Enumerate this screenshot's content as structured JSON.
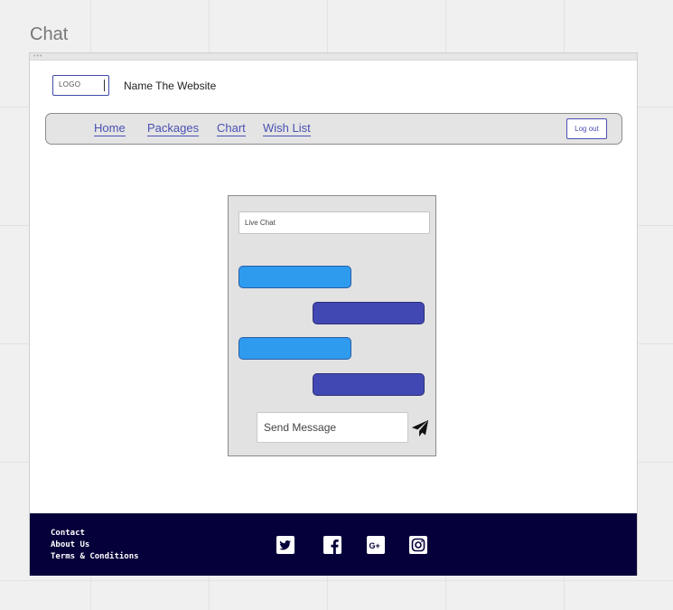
{
  "board": {
    "title": "Chat"
  },
  "header": {
    "logo_text": "LOGO",
    "site_name": "Name The Website"
  },
  "nav": {
    "items": [
      {
        "label": "Home"
      },
      {
        "label": "Packages"
      },
      {
        "label": "Chart"
      },
      {
        "label": "Wish List"
      }
    ],
    "logout_label": "Log out"
  },
  "chat": {
    "title": "Live Chat",
    "messages": [
      {
        "direction": "incoming",
        "color": "#2f9bef"
      },
      {
        "direction": "outgoing",
        "color": "#4248b3"
      },
      {
        "direction": "incoming",
        "color": "#2f9bef"
      },
      {
        "direction": "outgoing",
        "color": "#4248b3"
      }
    ],
    "input_placeholder": "Send Message",
    "send_icon": "paper-plane-icon"
  },
  "footer": {
    "background": "#06003a",
    "links": [
      {
        "label": "Contact"
      },
      {
        "label": "About Us"
      },
      {
        "label": "Terms & Conditions"
      }
    ],
    "social_icons": [
      "twitter-icon",
      "facebook-icon",
      "google-plus-icon",
      "instagram-icon"
    ]
  }
}
